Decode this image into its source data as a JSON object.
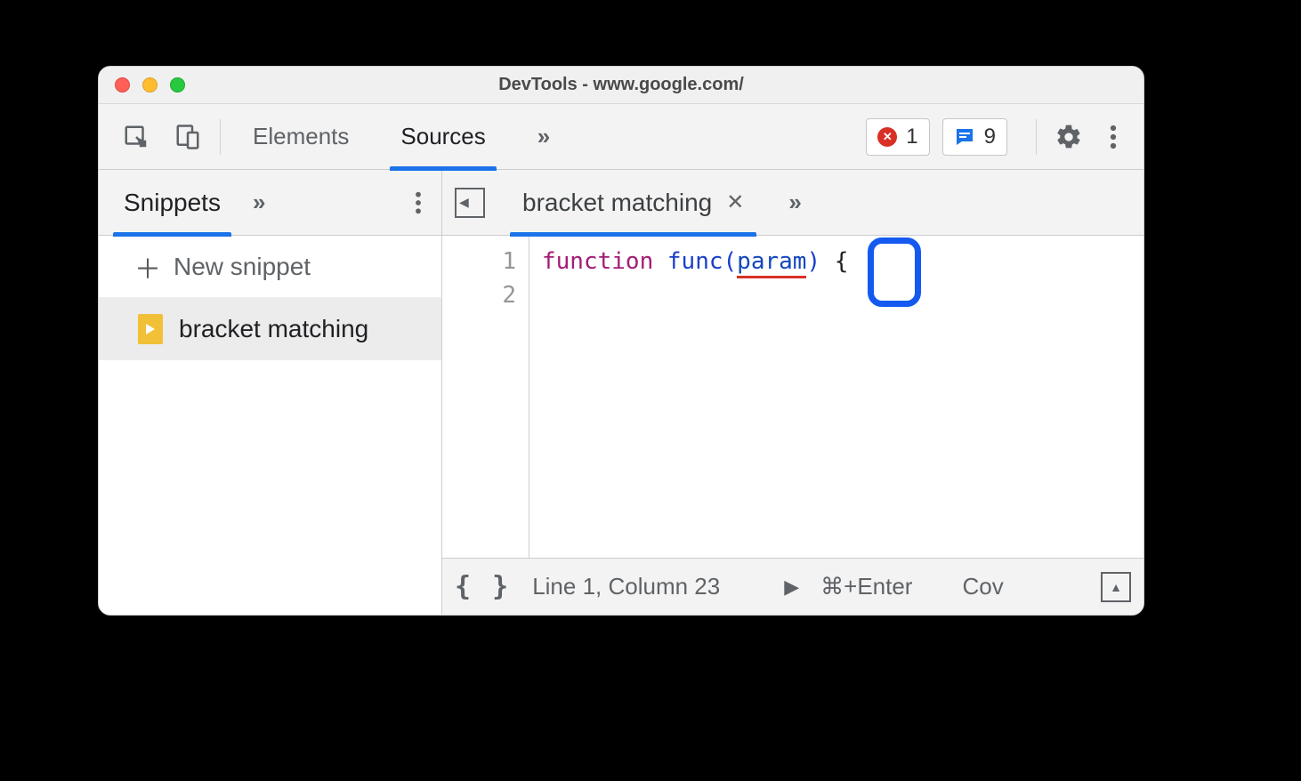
{
  "window": {
    "title": "DevTools - www.google.com/"
  },
  "toolbar": {
    "tabs": {
      "elements": "Elements",
      "sources": "Sources"
    },
    "overflow": "»",
    "errors_count": "1",
    "messages_count": "9"
  },
  "sidebar": {
    "tab_label": "Snippets",
    "overflow": "»",
    "new_snippet_label": "New snippet",
    "items": [
      {
        "label": "bracket matching"
      }
    ]
  },
  "editor": {
    "file_tab": "bracket matching",
    "overflow": "»",
    "gutter": [
      "1",
      "2"
    ],
    "code": {
      "keyword": "function",
      "func_name": "func",
      "open_paren": "(",
      "param": "param",
      "close_paren": ")",
      "brace": "{"
    }
  },
  "statusbar": {
    "braces": "{ }",
    "cursor_pos": "Line 1, Column 23",
    "run_glyph": "▶",
    "run_shortcut": "⌘+Enter",
    "coverage": "Cov"
  }
}
